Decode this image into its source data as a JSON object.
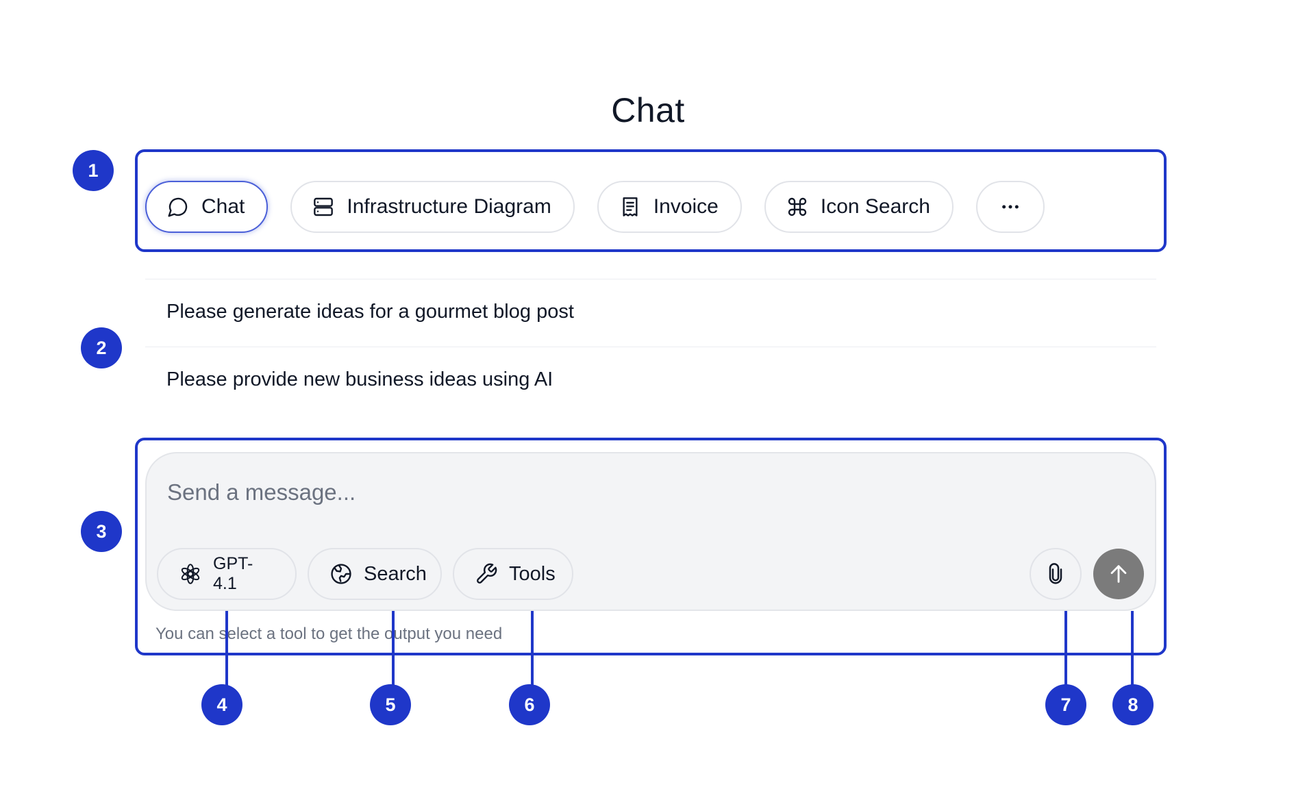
{
  "page": {
    "title": "Chat"
  },
  "tabs": [
    {
      "label": "Chat",
      "icon": "chat-bubble-icon",
      "active": true
    },
    {
      "label": "Infrastructure Diagram",
      "icon": "server-icon",
      "active": false
    },
    {
      "label": "Invoice",
      "icon": "invoice-icon",
      "active": false
    },
    {
      "label": "Icon Search",
      "icon": "command-icon",
      "active": false
    },
    {
      "label": "",
      "icon": "more-dots-icon",
      "active": false
    }
  ],
  "suggestions": [
    "Please generate ideas for a gourmet blog post",
    "Please provide new business ideas using AI"
  ],
  "composer": {
    "placeholder": "Send a message...",
    "model_label": "GPT-4.1",
    "search_label": "Search",
    "tools_label": "Tools",
    "hint": "You can select a tool to get the output you need"
  },
  "annotations": [
    "1",
    "2",
    "3",
    "4",
    "5",
    "6",
    "7",
    "8"
  ],
  "colors": {
    "annotation": "#1f37c9",
    "send_button": "#7b7b7b",
    "composer_bg": "#f3f4f6",
    "active_tab_border": "#4a5fd8"
  }
}
